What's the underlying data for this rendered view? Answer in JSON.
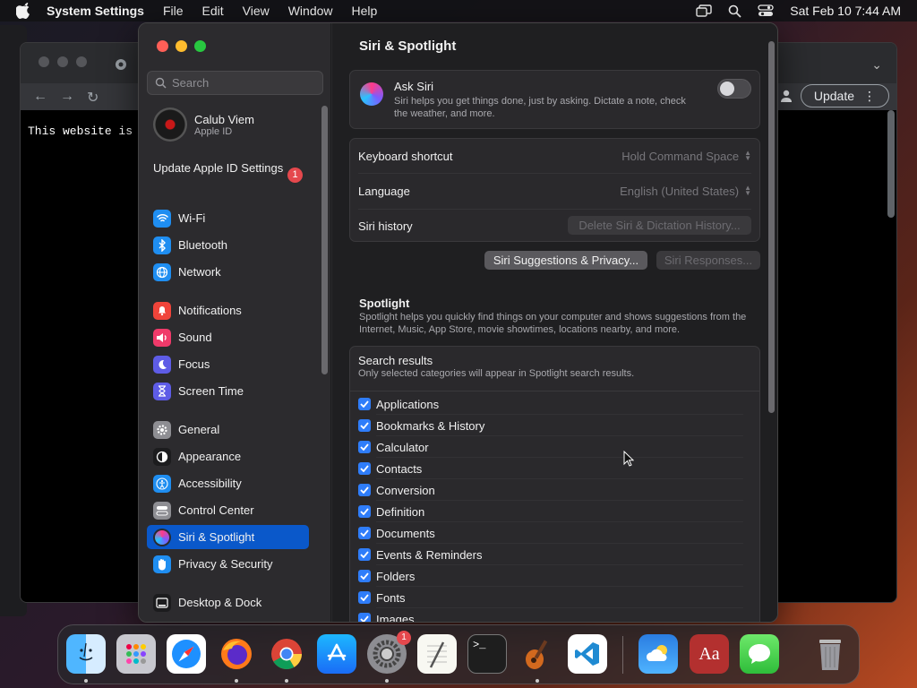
{
  "menubar": {
    "app_name": "System Settings",
    "items": [
      "File",
      "Edit",
      "View",
      "Window",
      "Help"
    ],
    "datetime": "Sat Feb 10  7:44 AM"
  },
  "browser": {
    "page_text": "This website is",
    "update_label": "Update"
  },
  "settings": {
    "search_placeholder": "Search",
    "user": {
      "name": "Calub Viem",
      "subtitle": "Apple ID"
    },
    "update_apple_id": "Update Apple ID Settings",
    "update_badge": "1",
    "sidebar": [
      {
        "label": "Wi-Fi",
        "icon": "wifi-icon",
        "color": "#1f8ef1"
      },
      {
        "label": "Bluetooth",
        "icon": "bluetooth-icon",
        "color": "#1f8ef1"
      },
      {
        "label": "Network",
        "icon": "globe-icon",
        "color": "#1f8ef1"
      },
      {
        "label": "Notifications",
        "icon": "bell-icon",
        "color": "#f0443a"
      },
      {
        "label": "Sound",
        "icon": "speaker-icon",
        "color": "#f03a6a"
      },
      {
        "label": "Focus",
        "icon": "moon-icon",
        "color": "#5e5ce6"
      },
      {
        "label": "Screen Time",
        "icon": "hourglass-icon",
        "color": "#5e5ce6"
      },
      {
        "label": "General",
        "icon": "gear-icon",
        "color": "#8e8e93"
      },
      {
        "label": "Appearance",
        "icon": "appearance-icon",
        "color": "#1c1c1e"
      },
      {
        "label": "Accessibility",
        "icon": "accessibility-icon",
        "color": "#1f8ef1"
      },
      {
        "label": "Control Center",
        "icon": "control-center-icon",
        "color": "#8e8e93"
      },
      {
        "label": "Siri & Spotlight",
        "icon": "siri-icon",
        "color": "#2a2a2e"
      },
      {
        "label": "Privacy & Security",
        "icon": "hand-icon",
        "color": "#1f8ef1"
      },
      {
        "label": "Desktop & Dock",
        "icon": "dock-icon",
        "color": "#1c1c1e"
      }
    ],
    "active_item": "Siri & Spotlight",
    "pane_title": "Siri & Spotlight",
    "ask_siri": {
      "title": "Ask Siri",
      "description": "Siri helps you get things done, just by asking. Dictate a note, check the weather, and more.",
      "enabled": false
    },
    "rows": {
      "keyboard_shortcut": {
        "label": "Keyboard shortcut",
        "value": "Hold Command Space"
      },
      "language": {
        "label": "Language",
        "value": "English (United States)"
      },
      "siri_history": {
        "label": "Siri history",
        "button": "Delete Siri & Dictation History..."
      }
    },
    "buttons": {
      "suggestions_privacy": "Siri Suggestions & Privacy...",
      "responses": "Siri Responses..."
    },
    "spotlight": {
      "title": "Spotlight",
      "description": "Spotlight helps you quickly find things on your computer and shows suggestions from the Internet, Music, App Store, movie showtimes, locations nearby, and more.",
      "results_title": "Search results",
      "results_subtitle": "Only selected categories will appear in Spotlight search results.",
      "categories": [
        "Applications",
        "Bookmarks & History",
        "Calculator",
        "Contacts",
        "Conversion",
        "Definition",
        "Documents",
        "Events & Reminders",
        "Folders",
        "Fonts",
        "Images"
      ]
    }
  },
  "dock": {
    "apps": [
      "finder-icon",
      "launchpad-icon",
      "safari-icon",
      "firefox-icon",
      "chrome-icon",
      "app-store-icon",
      "system-settings-icon",
      "textedit-icon",
      "terminal-icon",
      "garageband-icon",
      "vscode-icon",
      "weather-icon",
      "dictionary-icon",
      "messages-icon",
      "trash-icon"
    ],
    "settings_badge": "1"
  }
}
